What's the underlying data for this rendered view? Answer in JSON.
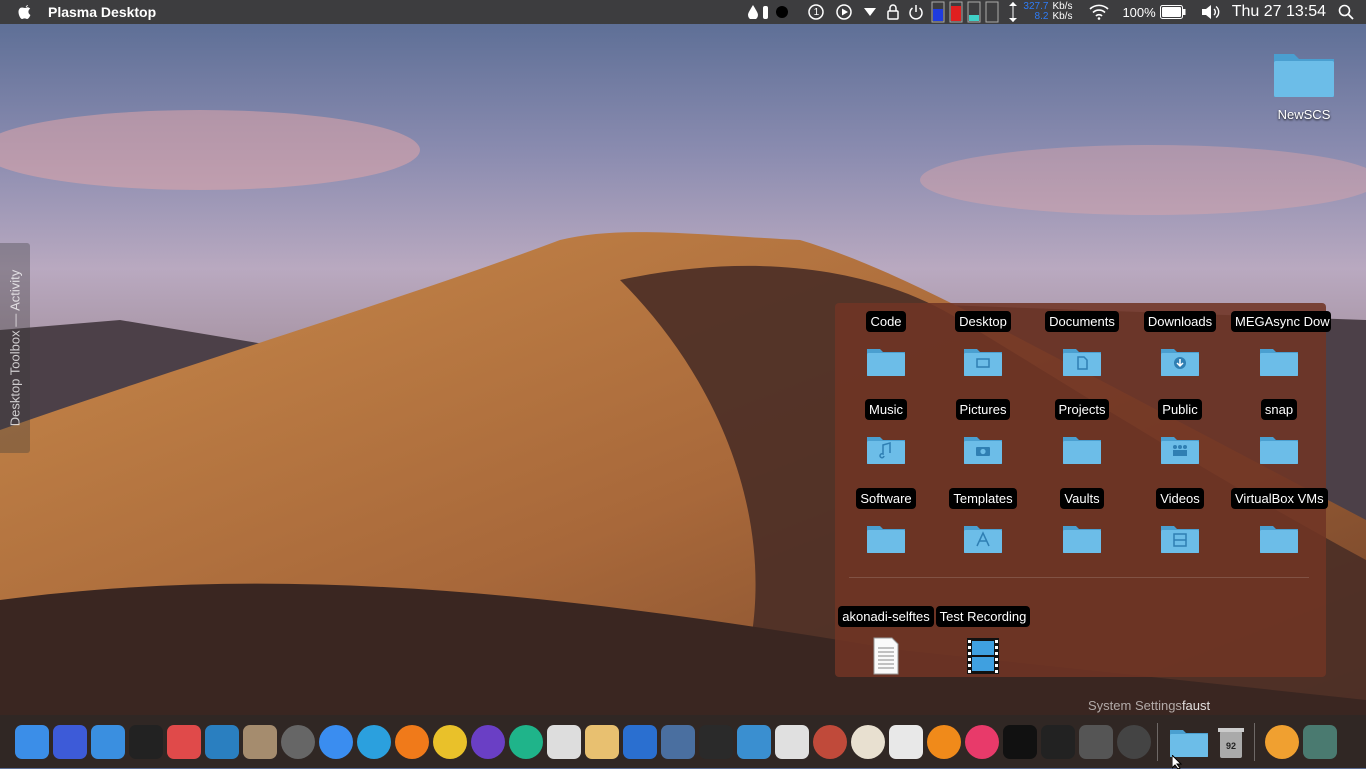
{
  "topbar": {
    "app_title": "Plasma Desktop",
    "net_up": "327.7",
    "net_down": "8.2",
    "net_unit": "Kb/s",
    "battery": "100%",
    "datetime": "Thu 27  13:54",
    "tray_num": "1"
  },
  "sidebar": {
    "label": "Desktop Toolbox — Activity"
  },
  "desktop_icons": [
    {
      "label": "NewSCS"
    }
  ],
  "folder_view": {
    "folders": [
      {
        "label": "Code",
        "icon": "folder-icon"
      },
      {
        "label": "Desktop",
        "icon": "folder-desktop-icon"
      },
      {
        "label": "Documents",
        "icon": "folder-documents-icon"
      },
      {
        "label": "Downloads",
        "icon": "folder-downloads-icon"
      },
      {
        "label": "MEGAsync Dow",
        "icon": "folder-icon"
      },
      {
        "label": "Music",
        "icon": "folder-music-icon"
      },
      {
        "label": "Pictures",
        "icon": "folder-pictures-icon"
      },
      {
        "label": "Projects",
        "icon": "folder-icon"
      },
      {
        "label": "Public",
        "icon": "folder-public-icon"
      },
      {
        "label": "snap",
        "icon": "folder-icon"
      },
      {
        "label": "Software",
        "icon": "folder-icon"
      },
      {
        "label": "Templates",
        "icon": "folder-templates-icon"
      },
      {
        "label": "Vaults",
        "icon": "folder-icon"
      },
      {
        "label": "Videos",
        "icon": "folder-videos-icon"
      },
      {
        "label": "VirtualBox VMs",
        "icon": "folder-icon"
      }
    ],
    "files": [
      {
        "label": "akonadi-selftes",
        "icon": "text-file-icon"
      },
      {
        "label": "Test Recording",
        "icon": "video-file-icon"
      }
    ]
  },
  "status_label": {
    "prefix": "System Settings",
    "user": "faust"
  },
  "dock": {
    "apps": [
      "finder-icon",
      "kde-connect-icon",
      "files-icon",
      "phone-icon",
      "news-icon",
      "disk-icon",
      "photo-tool-icon",
      "settings-icon",
      "messenger-icon",
      "telegram-icon",
      "firefox-icon",
      "chrome-icon",
      "vscode-icon",
      "atom-icon",
      "text-editor-icon",
      "notes-icon",
      "charts-icon",
      "scanner-icon",
      "video-editor-icon",
      "image-viewer-icon",
      "photos-icon",
      "hotcam-icon",
      "photos-flower-icon",
      "screenshot-icon",
      "vlc-icon",
      "itunes-icon",
      "terminal-icon",
      "system-monitor-icon",
      "network-icon",
      "system-settings-icon"
    ],
    "right": [
      "folder-icon",
      "trash-icon",
      "cd-icon",
      "tools-icon"
    ],
    "trash_count": "92"
  },
  "colors": {
    "topbar": "#3d3d3f",
    "panel": "#703424",
    "folder": "#5aa9d6",
    "accent": "#2e7cf6"
  }
}
